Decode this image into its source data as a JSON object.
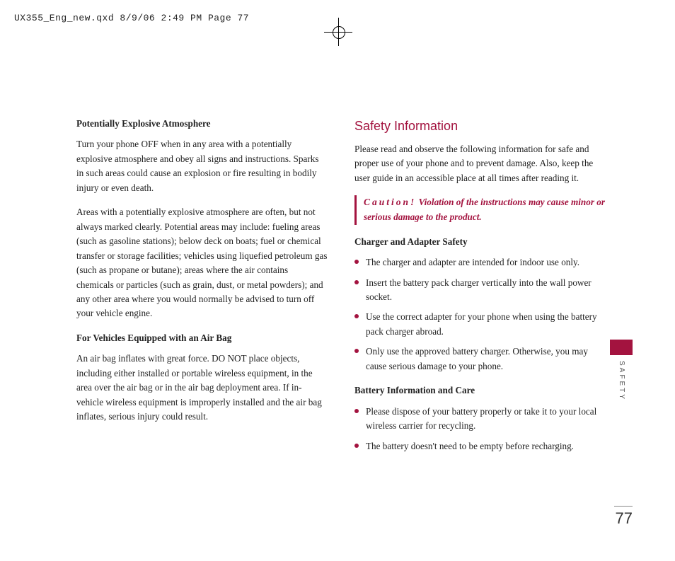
{
  "header": "UX355_Eng_new.qxd  8/9/06  2:49 PM  Page 77",
  "left": {
    "h1": "Potentially Explosive Atmosphere",
    "p1": "Turn your phone OFF when in any area with a potentially explosive atmosphere and obey all signs and instructions. Sparks in such areas could cause an explosion or fire resulting in bodily injury or even death.",
    "p2": "Areas with a potentially explosive atmosphere are often, but not always marked clearly. Potential areas may include: fueling areas (such as gasoline stations); below deck on boats; fuel or chemical transfer or storage facilities; vehicles using liquefied petroleum gas (such as propane or butane); areas where the air contains chemicals or particles (such as grain, dust, or metal powders); and any other area where you would normally be advised to turn off your vehicle engine.",
    "h2": "For Vehicles Equipped with an Air Bag",
    "p3": "An air bag inflates with great force. DO NOT place objects, including either installed or portable wireless equipment, in the area over the air bag or in the air bag deployment area. If in-vehicle wireless equipment is improperly installed and the air bag inflates, serious injury could result."
  },
  "right": {
    "title": "Safety Information",
    "intro": "Please read and observe the following information for safe and proper use of your phone and to prevent damage. Also, keep the user guide in an accessible place at all times after reading it.",
    "caution_lead": "Caution!",
    "caution_text": "Violation of the instructions may cause minor or serious damage to the product.",
    "h1": "Charger and Adapter Safety",
    "b1": "The charger and adapter are intended for indoor use only.",
    "b2": "Insert the battery pack charger vertically into the wall power socket.",
    "b3": "Use the correct adapter for your phone when using the battery pack charger abroad.",
    "b4": "Only use the approved battery charger. Otherwise, you may cause serious damage to your phone.",
    "h2": "Battery Information and Care",
    "b5": "Please dispose of your battery properly or take it to your local wireless carrier for recycling.",
    "b6": "The battery doesn't need to be empty before recharging."
  },
  "side_label": "SAFETY",
  "page_number": "77"
}
